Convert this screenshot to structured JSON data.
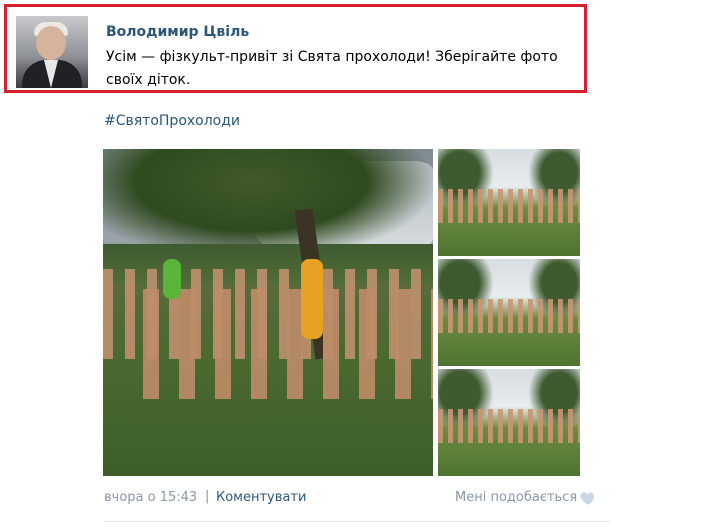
{
  "post": {
    "author": "Володимир Цвіль",
    "text": "Усім — фізкульт-привіт зі Свята прохолоди! Зберігайте фото своїх діток.",
    "hashtag": "#СвятоПрохолоди",
    "time": "вчора о 15:43",
    "separator": "|",
    "comment_label": "Коментувати",
    "like_label": "Мені подобається"
  },
  "icons": {
    "like": "heart-icon"
  },
  "colors": {
    "link": "#2b587a",
    "meta": "#8a97a6",
    "highlight_border": "#d8202d"
  }
}
